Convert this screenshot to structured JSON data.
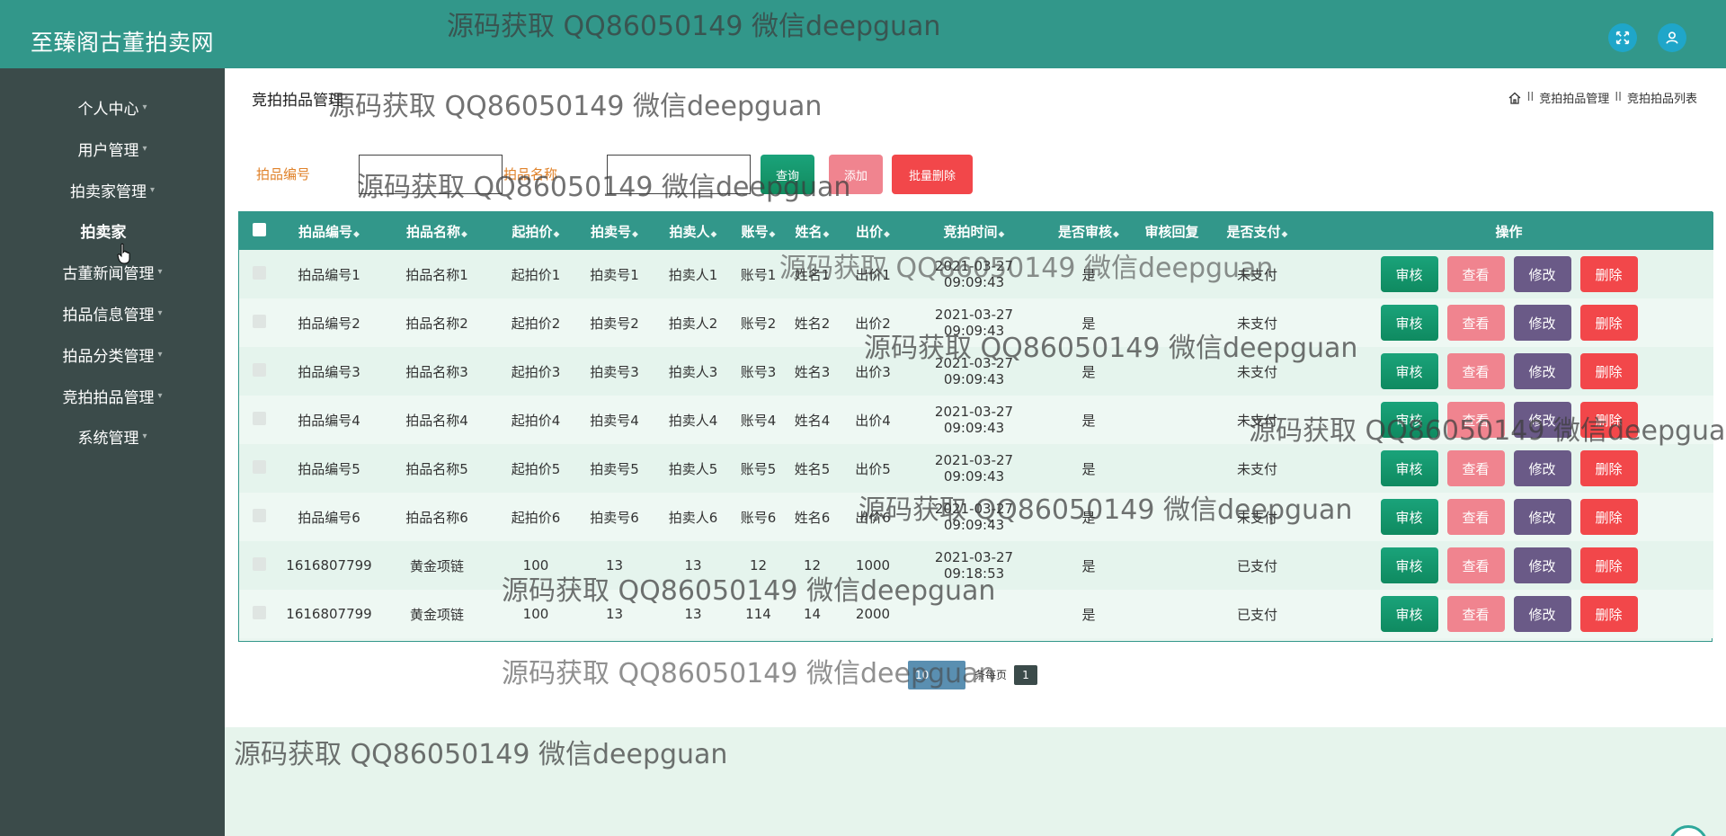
{
  "header": {
    "brand": "至臻阁古董拍卖网",
    "fullscreen_icon": "fullscreen-icon",
    "user_icon": "user-icon",
    "color": "#32978a"
  },
  "sidebar": {
    "items": [
      {
        "label": "个人中心",
        "arrow": "▾"
      },
      {
        "label": "用户管理",
        "arrow": "▾"
      },
      {
        "label": "拍卖家管理",
        "arrow": "▾"
      },
      {
        "label": "拍卖家",
        "arrow": ""
      },
      {
        "label": "古董新闻管理",
        "arrow": "▾"
      },
      {
        "label": "拍品信息管理",
        "arrow": "▾"
      },
      {
        "label": "拍品分类管理",
        "arrow": "▾"
      },
      {
        "label": "竞拍拍品管理",
        "arrow": "▾"
      },
      {
        "label": "系统管理",
        "arrow": "▾"
      }
    ]
  },
  "main": {
    "heading": "竞拍拍品管理",
    "breadcrumb": {
      "icon": "home-icon",
      "sep": "II",
      "level1": "竞拍拍品管理",
      "level2": "竞拍拍品列表"
    }
  },
  "search": {
    "label1": "拍品编号",
    "input1_value": "",
    "label2": "拍品名称",
    "input2_value": "",
    "query_label": "查询",
    "add_label": "添加",
    "batch_delete_label": "批量删除"
  },
  "table": {
    "headers": [
      "拍品编号",
      "拍品名称",
      "起拍价",
      "拍卖号",
      "拍卖人",
      "账号",
      "姓名",
      "出价",
      "竞拍时间",
      "是否审核",
      "审核回复",
      "是否支付",
      "操作"
    ],
    "sort_glyph": "◆",
    "rows": [
      [
        "拍品编号1",
        "拍品名称1",
        "起拍价1",
        "拍卖号1",
        "拍卖人1",
        "账号1",
        "姓名1",
        "出价1",
        "2021-03-27 09:09:43",
        "是",
        "",
        "未支付"
      ],
      [
        "拍品编号2",
        "拍品名称2",
        "起拍价2",
        "拍卖号2",
        "拍卖人2",
        "账号2",
        "姓名2",
        "出价2",
        "2021-03-27 09:09:43",
        "是",
        "",
        "未支付"
      ],
      [
        "拍品编号3",
        "拍品名称3",
        "起拍价3",
        "拍卖号3",
        "拍卖人3",
        "账号3",
        "姓名3",
        "出价3",
        "2021-03-27 09:09:43",
        "是",
        "",
        "未支付"
      ],
      [
        "拍品编号4",
        "拍品名称4",
        "起拍价4",
        "拍卖号4",
        "拍卖人4",
        "账号4",
        "姓名4",
        "出价4",
        "2021-03-27 09:09:43",
        "是",
        "",
        "未支付"
      ],
      [
        "拍品编号5",
        "拍品名称5",
        "起拍价5",
        "拍卖号5",
        "拍卖人5",
        "账号5",
        "姓名5",
        "出价5",
        "2021-03-27 09:09:43",
        "是",
        "",
        "未支付"
      ],
      [
        "拍品编号6",
        "拍品名称6",
        "起拍价6",
        "拍卖号6",
        "拍卖人6",
        "账号6",
        "姓名6",
        "出价6",
        "2021-03-27 09:09:43",
        "是",
        "",
        "未支付"
      ],
      [
        "1616807799",
        "黄金项链",
        "100",
        "13",
        "13",
        "12",
        "12",
        "1000",
        "2021-03-27 09:18:53",
        "是",
        "",
        "已支付"
      ],
      [
        "1616807799",
        "黄金项链",
        "100",
        "13",
        "13",
        "114",
        "14",
        "2000",
        "",
        "是",
        "",
        "已支付"
      ]
    ],
    "actions": {
      "approve": "审核",
      "view": "查看",
      "edit": "修改",
      "delete": "删除"
    }
  },
  "pagination": {
    "page_size": "10",
    "per_page_label": "条每页",
    "current_page": "1"
  },
  "watermark": "源码获取 QQ86050149 微信deepguan"
}
